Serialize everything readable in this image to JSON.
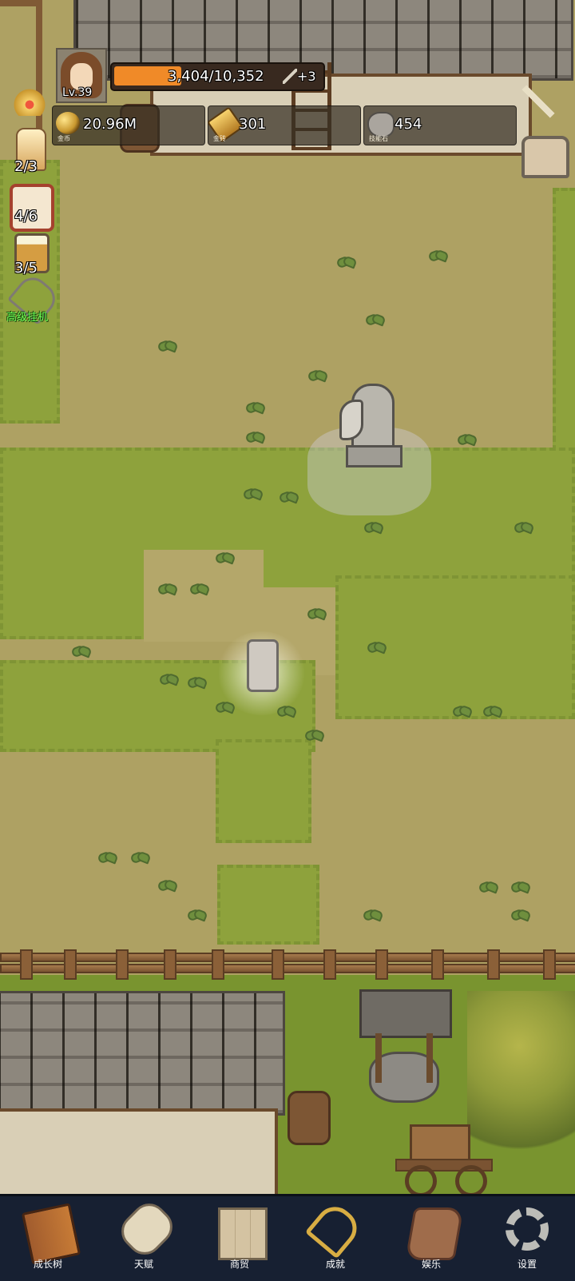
{
  "player": {
    "level": "Lv.39",
    "xp_text": "3,404/10,352",
    "xp_progress": 0.329,
    "bonus": "+3"
  },
  "resources": [
    {
      "icon": "gold-coin-icon",
      "value": "20.96M",
      "caption": "金币"
    },
    {
      "icon": "gold-brick-icon",
      "value": "301",
      "caption": "金砖"
    },
    {
      "icon": "skill-stone-icon",
      "value": "454",
      "caption": "技能石"
    }
  ],
  "left_side": {
    "candle_count": "2/3",
    "dice_count": "4/6",
    "drink_count": "3/5",
    "idle_label": "高级挂机"
  },
  "nav": [
    {
      "label": "成长树",
      "icon": "book-icon"
    },
    {
      "label": "天赋",
      "icon": "scroll-icon"
    },
    {
      "label": "商贸",
      "icon": "map-icon"
    },
    {
      "label": "成就",
      "icon": "key-icon"
    },
    {
      "label": "娱乐",
      "icon": "cloth-icon"
    },
    {
      "label": "设置",
      "icon": "gear-icon"
    }
  ],
  "colors": {
    "xp_bar": "#f08a28",
    "nav_bg": "#172032",
    "grass": "#8ea23c",
    "dirt": "#b4a76a"
  }
}
